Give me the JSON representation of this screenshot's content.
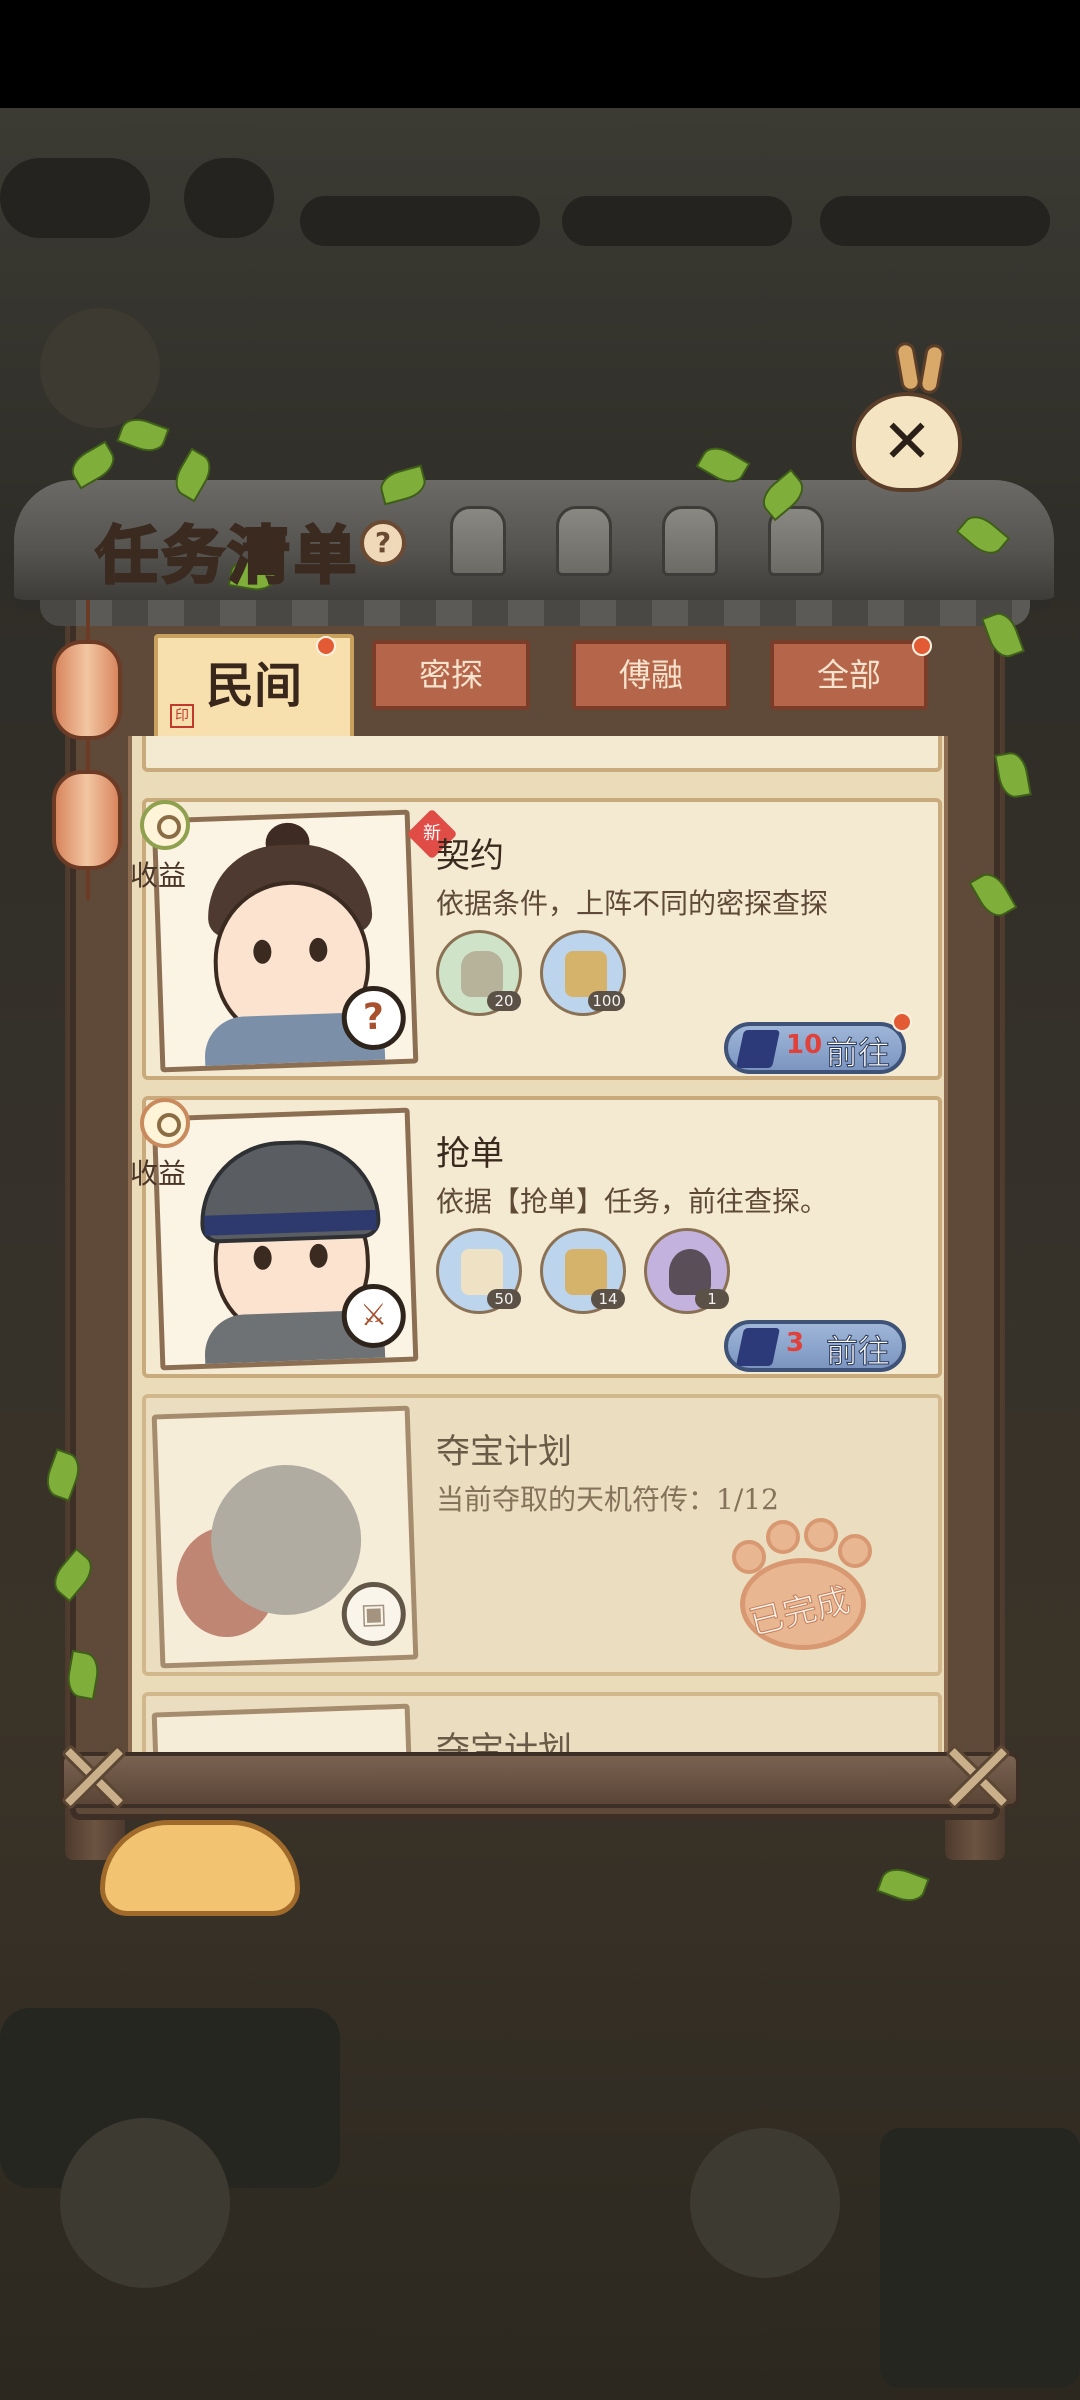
{
  "panel": {
    "title": "任务清单",
    "help_glyph": "?",
    "close_glyph": "✕"
  },
  "tabs": [
    {
      "label": "民间",
      "active": true,
      "has_dot": true
    },
    {
      "label": "密探",
      "active": false,
      "has_dot": false
    },
    {
      "label": "傅融",
      "active": false,
      "has_dot": false
    },
    {
      "label": "全部",
      "active": false,
      "has_dot": true
    }
  ],
  "tasks": [
    {
      "title": "契约",
      "is_new": true,
      "new_label": "新",
      "income_label": "收益",
      "description": "依据条件，上阵不同的密探查探",
      "badge_glyph": "?",
      "rewards": [
        {
          "icon": "wine-jar-icon",
          "qty": "20"
        },
        {
          "icon": "bronze-ding-icon",
          "qty": "100"
        }
      ],
      "cost": "10",
      "button_label": "前往",
      "button_dot": true,
      "completed": false
    },
    {
      "title": "抢单",
      "is_new": false,
      "income_label": "收益",
      "description": "依据【抢单】任务，前往查探。",
      "badge_glyph": "⚔",
      "rewards": [
        {
          "icon": "scroll-icon",
          "qty": "50"
        },
        {
          "icon": "bronze-ding-icon",
          "qty": "14"
        },
        {
          "icon": "incense-icon",
          "qty": "1"
        }
      ],
      "cost": "3",
      "button_label": "前往",
      "button_dot": false,
      "completed": false
    },
    {
      "title": "夺宝计划",
      "description": "当前夺取的天机符传：1/12",
      "badge_glyph": "▣",
      "completed": true,
      "completed_label": "已完成"
    },
    {
      "title": "夺宝计划",
      "partial": true
    }
  ],
  "colors": {
    "tab_active_bg": "#f7dfae",
    "tab_inactive_bg": "#b5654a",
    "go_button": "#8aa4cb",
    "cost_red": "#e0413a",
    "notify_dot": "#e35b35"
  }
}
